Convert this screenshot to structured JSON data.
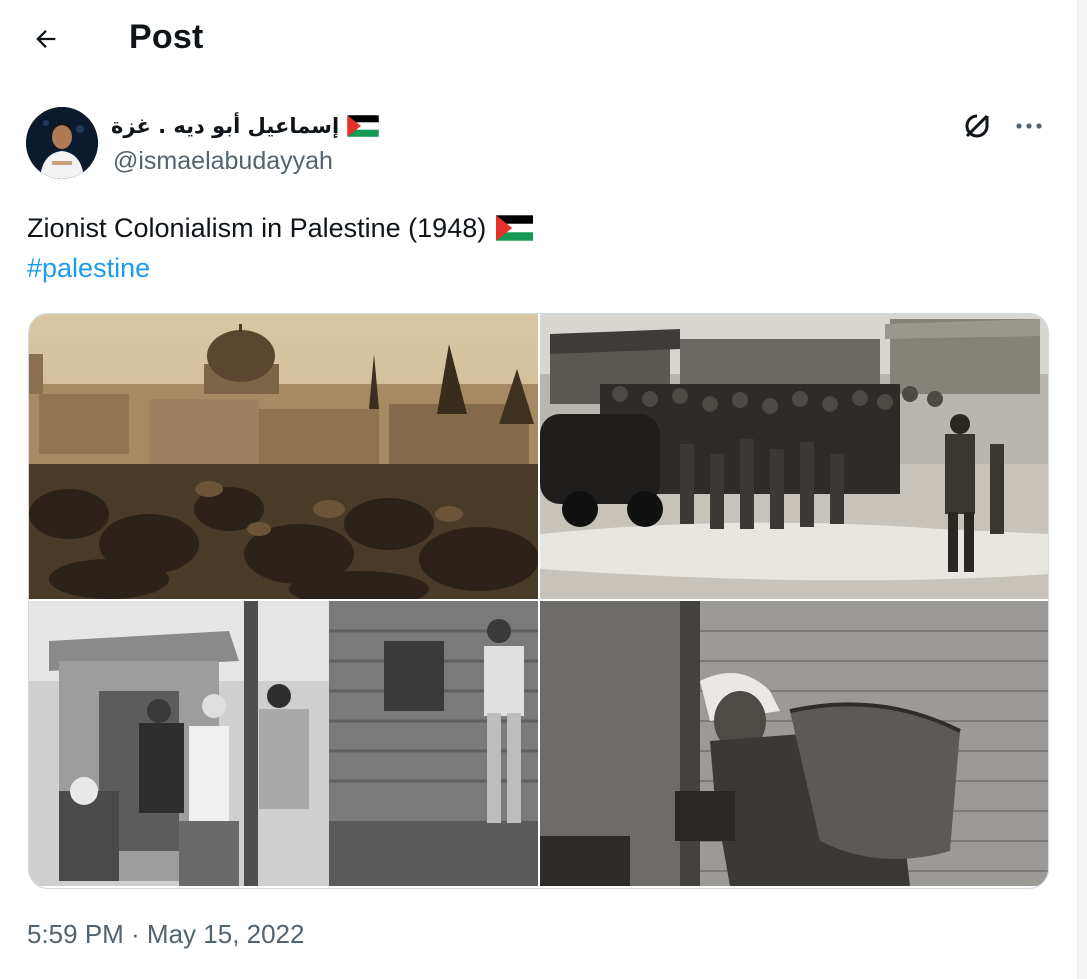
{
  "header": {
    "title": "Post",
    "back_icon": "arrow-left-icon"
  },
  "author": {
    "display_name": "إسماعيل أبو ديه . غزة",
    "flag_emoji": "palestine-flag-icon",
    "handle": "@ismaelabudayyah",
    "avatar_icon": "avatar"
  },
  "actions": {
    "grok_icon": "grok-icon",
    "more_icon": "more-icon"
  },
  "tweet": {
    "text": "Zionist Colonialism in Palestine (1948)",
    "hashtag": "#palestine"
  },
  "media": [
    {
      "name": "photo-jerusalem-dome"
    },
    {
      "name": "photo-crowd-soldiers"
    },
    {
      "name": "photo-soldiers-search"
    },
    {
      "name": "photo-man-carrying-sack"
    }
  ],
  "timestamp": "5:59 PM · May 15, 2022",
  "colors": {
    "link": "#1d9bf0",
    "secondary_text": "#536471",
    "border": "#cfd9de"
  }
}
